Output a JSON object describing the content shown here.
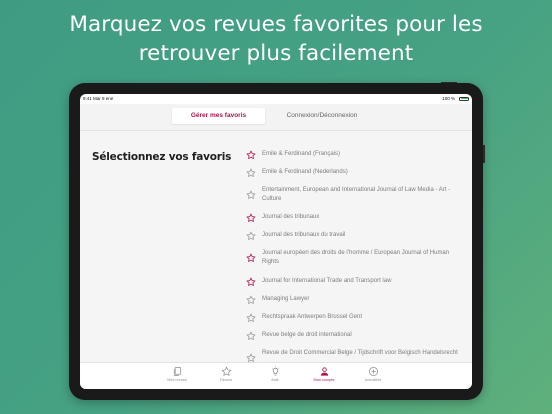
{
  "headline": {
    "line1": "Marquez vos revues favorites pour les",
    "line2": "retrouver plus facilement"
  },
  "statusbar": {
    "time": "9:41  Mar 9 ene",
    "battery": "100 %"
  },
  "segments": {
    "active": "Gérer mes favoris",
    "inactive": "Connexion/Déconnexion"
  },
  "section_title": "Sélectionnez vos favoris",
  "journals": [
    {
      "label": "Emile & Ferdinand (Français)",
      "favorite": true
    },
    {
      "label": "Emile & Ferdinand (Nederlands)",
      "favorite": false
    },
    {
      "label": "Entertainment, European and International Journal of Law Media - Art - Culture",
      "favorite": false
    },
    {
      "label": "Journal des tribunaux",
      "favorite": true
    },
    {
      "label": "Journal des tribunaux du travail",
      "favorite": false
    },
    {
      "label": "Journal européen des droits de l’homme / European Journal of Human Rights",
      "favorite": true
    },
    {
      "label": "Journal for International Trade and Transport law",
      "favorite": true
    },
    {
      "label": "Managing Lawyer",
      "favorite": false
    },
    {
      "label": "Rechtspraak Antwerpen Brussel Gent",
      "favorite": false
    },
    {
      "label": "Revue belge de droit international",
      "favorite": false
    },
    {
      "label": "Revue de Droit Commercial Belge / Tijdschrift voor Belgisch Handelsrecht",
      "favorite": false
    }
  ],
  "tabs": [
    {
      "label": "Mes revues",
      "icon": "documents-icon"
    },
    {
      "label": "Favoris",
      "icon": "star-icon"
    },
    {
      "label": "Aide",
      "icon": "lightbulb-icon"
    },
    {
      "label": "Mon compte",
      "icon": "user-icon",
      "active": true
    },
    {
      "label": "Actualités",
      "icon": "plus-circle-icon"
    }
  ],
  "colors": {
    "accent": "#b0154b",
    "star_inactive": "#9a9a9a",
    "background_gradient_start": "#3f9c83",
    "background_gradient_end": "#5fb07b"
  }
}
